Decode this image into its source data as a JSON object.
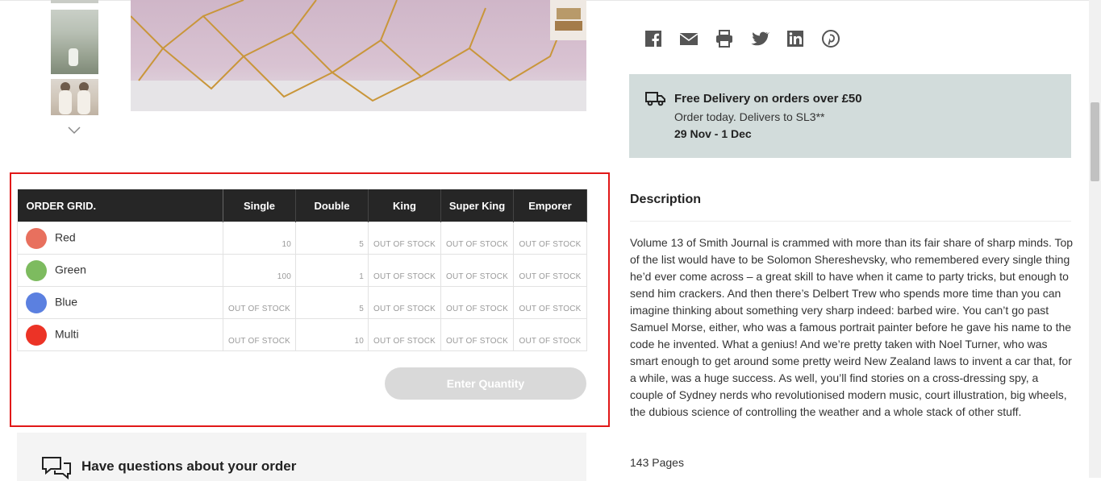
{
  "order_grid": {
    "columns": [
      "ORDER GRID.",
      "Single",
      "Double",
      "King",
      "Super King",
      "Emporer"
    ],
    "rows": [
      {
        "color_name": "Red",
        "swatch": "#e8705e",
        "values": [
          "10",
          "5",
          "OUT OF STOCK",
          "OUT OF STOCK",
          "OUT OF STOCK"
        ]
      },
      {
        "color_name": "Green",
        "swatch": "#7dbb5f",
        "values": [
          "100",
          "1",
          "OUT OF STOCK",
          "OUT OF STOCK",
          "OUT OF STOCK"
        ]
      },
      {
        "color_name": "Blue",
        "swatch": "#5b80e0",
        "values": [
          "OUT OF STOCK",
          "5",
          "OUT OF STOCK",
          "OUT OF STOCK",
          "OUT OF STOCK"
        ]
      },
      {
        "color_name": "Multi",
        "swatch": "#ec3326",
        "values": [
          "OUT OF STOCK",
          "10",
          "OUT OF STOCK",
          "OUT OF STOCK",
          "OUT OF STOCK"
        ]
      }
    ],
    "button_label": "Enter Quantity"
  },
  "questions": {
    "title": "Have questions about your order"
  },
  "share_icons": [
    "facebook-icon",
    "email-icon",
    "print-icon",
    "twitter-icon",
    "linkedin-icon",
    "pinterest-icon"
  ],
  "delivery": {
    "title": "Free Delivery on orders over £50",
    "line2": "Order today. Delivers to SL3**",
    "dates": "29 Nov - 1 Dec"
  },
  "description": {
    "title": "Description",
    "body": "Volume 13 of Smith Journal is crammed with more than its fair share of sharp minds. Top of the list would have to be Solomon Shereshevsky, who remembered every single thing he’d ever come across – a great skill to have when it came to party tricks, but enough to send him crackers. And then there’s Delbert Trew who spends more time than you can imagine thinking about something very sharp indeed: barbed wire. You can’t go past Samuel Morse, either, who was a famous portrait painter before he gave his name to the code he invented. What a genius! And we’re pretty taken with Noel Turner, who was smart enough to get around some pretty weird New Zealand laws to invent a car that, for a while, was a huge success. As well, you’ll find stories on a cross-dressing spy, a couple of Sydney nerds who revolutionised modern music, court illustration, big wheels, the dubious science of controlling the weather and a whole stack of other stuff.",
    "pages": "143 Pages"
  }
}
